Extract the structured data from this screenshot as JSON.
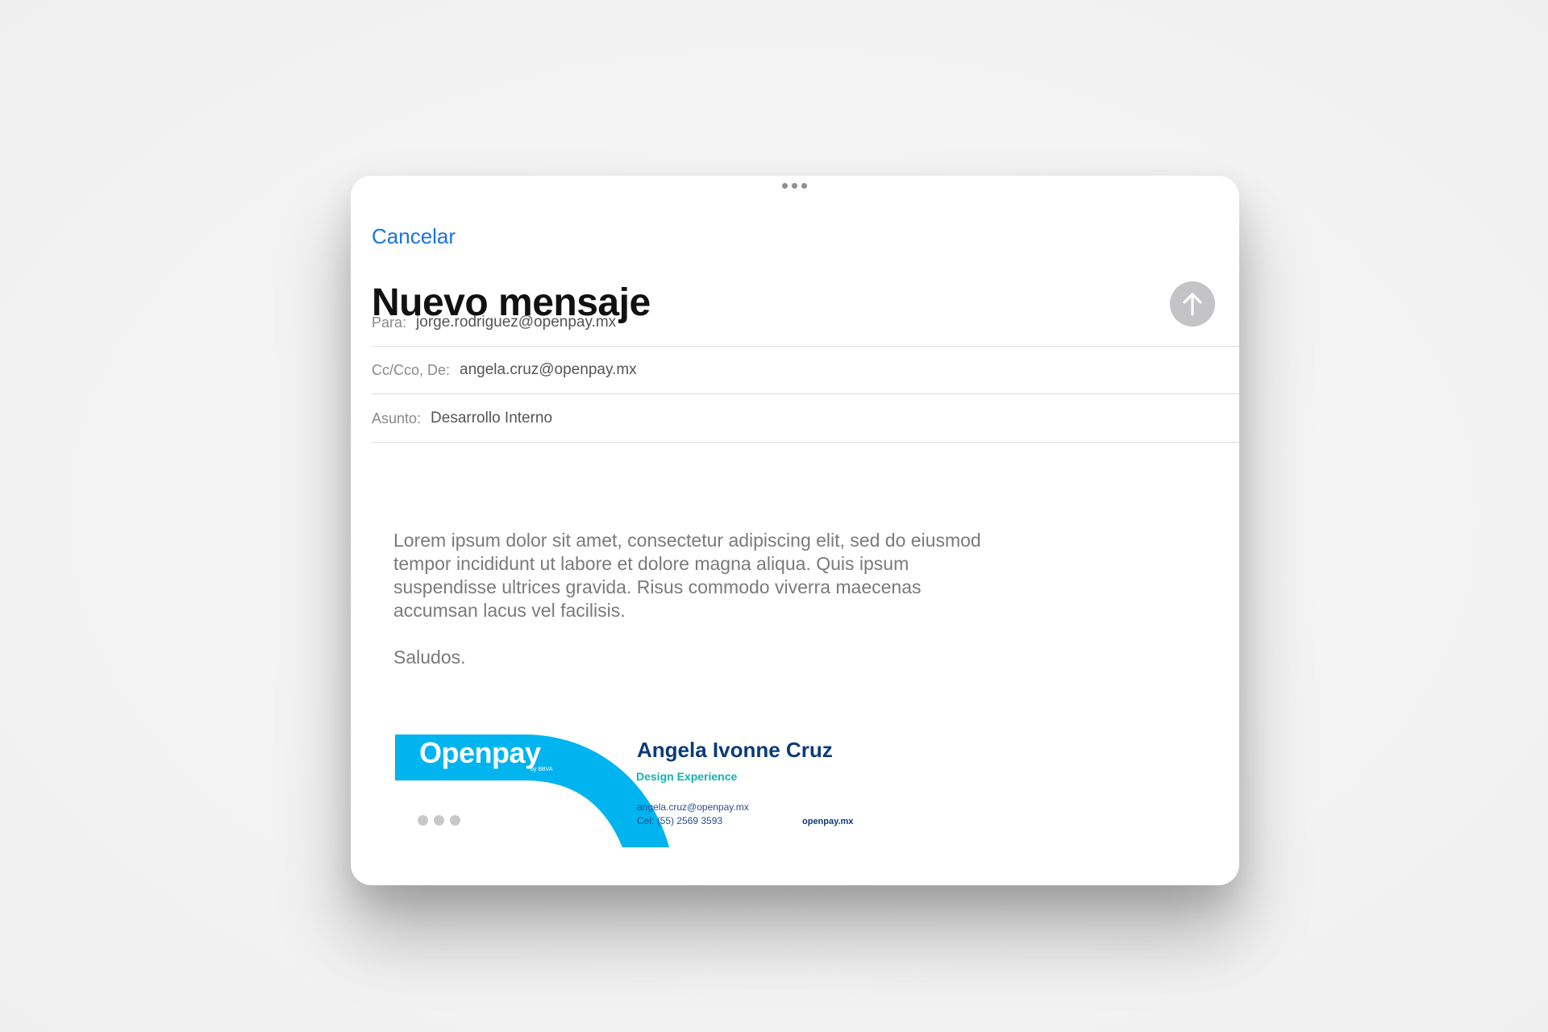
{
  "compose": {
    "cancel_label": "Cancelar",
    "title": "Nuevo mensaje",
    "send_icon": "arrow-up-icon",
    "accent_color": "#1a73e8"
  },
  "fields": {
    "to": {
      "label": "Para:",
      "value": "jorge.rodriguez@openpay.mx"
    },
    "cc": {
      "label": "Cc/Cco, De:",
      "value": "angela.cruz@openpay.mx"
    },
    "subject": {
      "label": "Asunto:",
      "value": "Desarrollo Interno"
    }
  },
  "message": {
    "body": "Lorem ipsum dolor sit amet, consectetur adipiscing elit, sed do eiusmod tempor incididunt ut labore et dolore magna aliqua. Quis ipsum suspendisse ultrices gravida. Risus commodo viverra maecenas accumsan lacus vel facilisis.",
    "greeting": "Saludos."
  },
  "signature": {
    "brand": "Openpay",
    "brand_sub": "by BBVA",
    "brand_color": "#00b4ef",
    "name": "Angela Ivonne Cruz",
    "role": "Design Experience",
    "email": "angela.cruz@openpay.mx",
    "phone": "Cel: (55) 2569 3593",
    "website": "openpay.mx",
    "social_icons": [
      "facebook-icon",
      "twitter-icon",
      "instagram-icon"
    ]
  }
}
